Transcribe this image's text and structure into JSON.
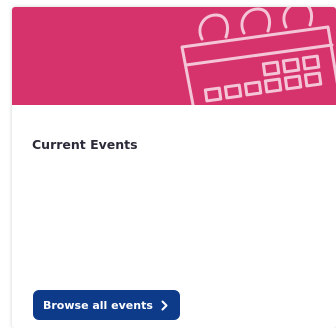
{
  "card": {
    "title": "Current Events",
    "browse_button_label": "Browse all events",
    "banner_icon": "calendar-icon",
    "button_icon": "chevron-right-icon"
  },
  "colors": {
    "banner": "#d6336c",
    "button": "#0e3a8a",
    "title_text": "#2a2a38"
  }
}
